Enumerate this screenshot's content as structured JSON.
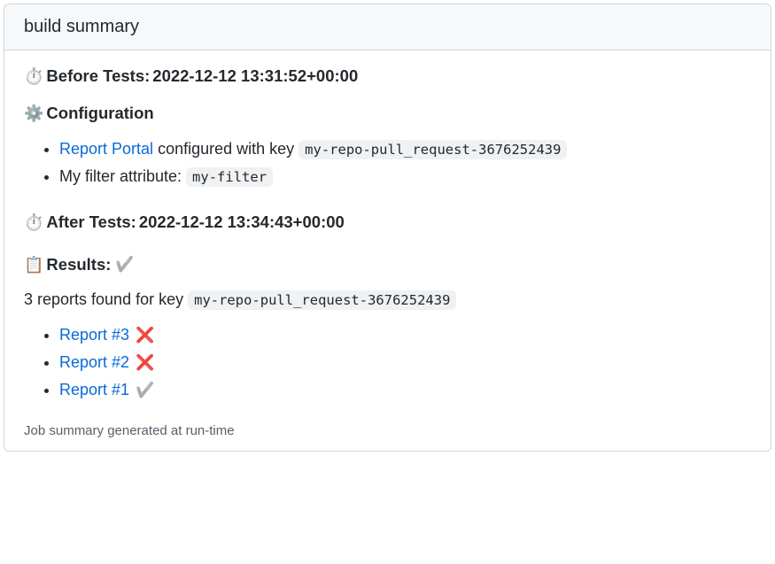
{
  "panel_title": "build summary",
  "before_tests": {
    "icon": "⏱️",
    "label": "Before Tests: ",
    "timestamp": "2022-12-12 13:31:52+00:00"
  },
  "configuration": {
    "icon": "⚙️",
    "label": "Configuration",
    "items": [
      {
        "link_text": "Report Portal",
        "after_link": " configured with key ",
        "code": "my-repo-pull_request-3676252439"
      },
      {
        "text": "My filter attribute: ",
        "code": "my-filter"
      }
    ]
  },
  "after_tests": {
    "icon": "⏱️",
    "label": "After Tests: ",
    "timestamp": "2022-12-12 13:34:43+00:00"
  },
  "results": {
    "icon": "📋",
    "label": "Results: ",
    "status_icon": "✔️",
    "found_prefix": "3 reports found for key ",
    "found_code": "my-repo-pull_request-3676252439",
    "reports": [
      {
        "label": "Report #3",
        "status_icon": "❌"
      },
      {
        "label": "Report #2",
        "status_icon": "❌"
      },
      {
        "label": "Report #1",
        "status_icon": "✔️"
      }
    ]
  },
  "footer": "Job summary generated at run-time"
}
